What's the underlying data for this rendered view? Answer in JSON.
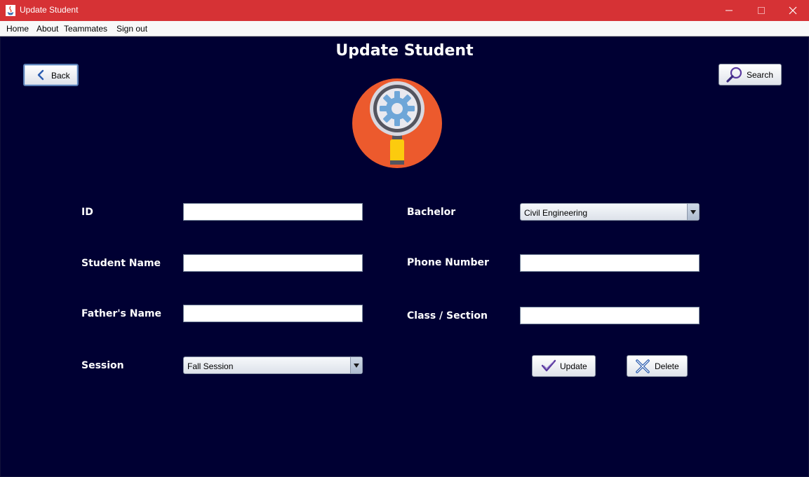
{
  "window": {
    "title": "Update Student"
  },
  "menu": [
    "Home",
    "About",
    "Teammates",
    "Sign out"
  ],
  "page": {
    "title": "Update Student"
  },
  "buttons": {
    "back": "Back",
    "search": "Search",
    "update": "Update",
    "delete": "Delete"
  },
  "form": {
    "id": {
      "label": "ID",
      "value": ""
    },
    "student_name": {
      "label": "Student Name",
      "value": ""
    },
    "fathers_name": {
      "label": "Father's Name",
      "value": ""
    },
    "session": {
      "label": "Session",
      "value": "Fall Session"
    },
    "bachelor": {
      "label": "Bachelor",
      "value": "Civil Engineering"
    },
    "phone": {
      "label": "Phone Number",
      "value": ""
    },
    "class_section": {
      "label": "Class / Section",
      "value": ""
    }
  },
  "icons": {
    "logo": "search-settings-icon",
    "back": "chevron-left-icon",
    "search": "magnifier-icon",
    "update": "checkmark-icon",
    "delete": "cross-icon"
  },
  "colors": {
    "title_bar": "#d63235",
    "background": "#000033",
    "logo_circle": "#ec5a2d"
  }
}
